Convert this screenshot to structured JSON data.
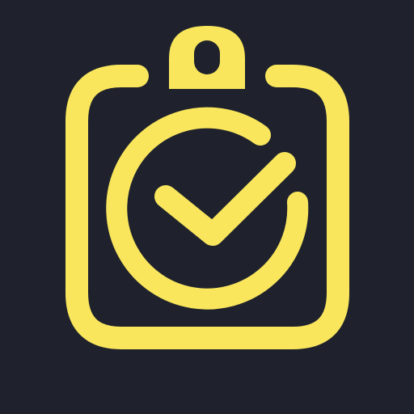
{
  "icon": {
    "name": "clipboard-check-icon",
    "background": "#1f222c",
    "accent": "#f9e65d"
  }
}
